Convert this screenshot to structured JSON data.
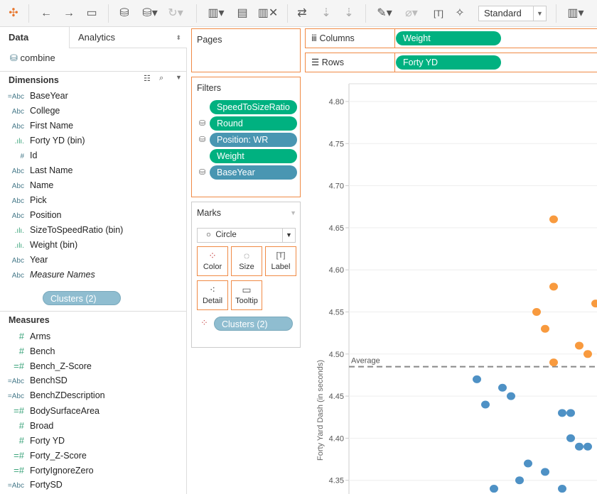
{
  "toolbar": {
    "mark_type_select": "Standard",
    "icons": [
      "tableau-logo-icon",
      "undo-icon",
      "redo-icon",
      "save-icon",
      "new-datasource-icon",
      "pause-updates-icon",
      "refresh-icon",
      "new-worksheet-icon",
      "duplicate-sheet-icon",
      "clear-sheet-icon",
      "swap-icon",
      "sort-ascending-icon",
      "sort-descending-icon",
      "highlight-icon",
      "group-icon",
      "labels-icon",
      "pin-axes-icon",
      "show-me-icon"
    ]
  },
  "left": {
    "tabs": [
      "Data",
      "Analytics"
    ],
    "datasource": "combine",
    "dimensions_title": "Dimensions",
    "dimensions": [
      {
        "icon": "=Abc",
        "label": "BaseYear"
      },
      {
        "icon": "Abc",
        "label": "College"
      },
      {
        "icon": "Abc",
        "label": "First Name"
      },
      {
        "icon": ".ılı.",
        "label": "Forty YD (bin)"
      },
      {
        "icon": "#",
        "label": "Id"
      },
      {
        "icon": "Abc",
        "label": "Last Name"
      },
      {
        "icon": "Abc",
        "label": "Name"
      },
      {
        "icon": "Abc",
        "label": "Pick"
      },
      {
        "icon": "Abc",
        "label": "Position"
      },
      {
        "icon": ".ılı.",
        "label": "SizeToSpeedRatio (bin)"
      },
      {
        "icon": ".ılı.",
        "label": "Weight (bin)"
      },
      {
        "icon": "Abc",
        "label": "Year"
      },
      {
        "icon": "Abc",
        "label": "Measure Names"
      }
    ],
    "clusters_pill": "Clusters (2)",
    "measures_title": "Measures",
    "measures": [
      {
        "icon": "#",
        "label": "Arms"
      },
      {
        "icon": "#",
        "label": "Bench"
      },
      {
        "icon": "=#",
        "label": "Bench_Z-Score"
      },
      {
        "icon": "=Abc",
        "label": "BenchSD"
      },
      {
        "icon": "=Abc",
        "label": "BenchZDescription"
      },
      {
        "icon": "=#",
        "label": "BodySurfaceArea"
      },
      {
        "icon": "#",
        "label": "Broad"
      },
      {
        "icon": "#",
        "label": "Forty YD"
      },
      {
        "icon": "=#",
        "label": "Forty_Z-Score"
      },
      {
        "icon": "=#",
        "label": "FortyIgnoreZero"
      },
      {
        "icon": "=Abc",
        "label": "FortySD"
      }
    ]
  },
  "pages": {
    "title": "Pages"
  },
  "filters": {
    "title": "Filters",
    "items": [
      {
        "label": "SpeedToSizeRatio",
        "color": "#00b180",
        "db": false
      },
      {
        "label": "Round",
        "color": "#00b180",
        "db": true
      },
      {
        "label": "Position: WR",
        "color": "#4996b2",
        "db": true
      },
      {
        "label": "Weight",
        "color": "#00b180",
        "db": false
      },
      {
        "label": "BaseYear",
        "color": "#4996b2",
        "db": true
      }
    ]
  },
  "marks": {
    "title": "Marks",
    "type": "Circle",
    "buttons": [
      "Color",
      "Size",
      "Label",
      "Detail",
      "Tooltip"
    ],
    "color_pill": "Clusters (2)"
  },
  "shelves": {
    "columns_label": "Columns",
    "columns_pill": "Weight",
    "rows_label": "Rows",
    "rows_pill": "Forty YD"
  },
  "chart_data": {
    "type": "scatter",
    "ylabel": "Forty Yard Dash (in seconds)",
    "ylim": [
      4.33,
      4.82
    ],
    "yticks": [
      "4.80",
      "4.75",
      "4.70",
      "4.65",
      "4.60",
      "4.55",
      "4.50",
      "4.45",
      "4.40",
      "4.35"
    ],
    "grid": true,
    "reference_line": {
      "label": "Average",
      "value": 4.485
    },
    "colors": {
      "cluster1": "#4e91c5",
      "cluster2": "#f89a3e"
    },
    "series": [
      {
        "cluster": 2,
        "y": [
          4.66,
          4.58,
          4.55,
          4.53,
          4.49,
          4.51,
          4.5,
          4.56
        ]
      },
      {
        "cluster": 1,
        "y": [
          4.47,
          4.44,
          4.46,
          4.45,
          4.43,
          4.43,
          4.4,
          4.39,
          4.39,
          4.37,
          4.36,
          4.35,
          4.34,
          4.34
        ]
      }
    ]
  }
}
